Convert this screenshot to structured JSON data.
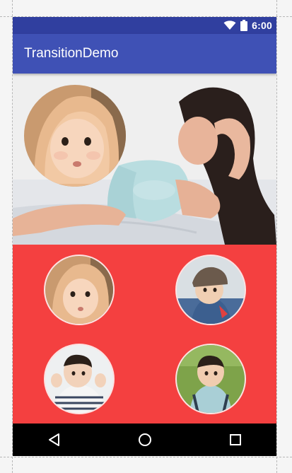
{
  "status_bar": {
    "time": "6:00",
    "icons": [
      "wifi-icon",
      "battery-icon"
    ],
    "color": "#303F9F"
  },
  "app_bar": {
    "title": "TransitionDemo",
    "color": "#3F51B5"
  },
  "hero": {
    "image": "woman-lying-photo",
    "overlay_avatar": "baby-hood-photo"
  },
  "grid": {
    "background": "#F44040",
    "avatars": [
      {
        "image": "baby-hood-photo"
      },
      {
        "image": "toddler-cap-photo"
      },
      {
        "image": "toddler-striped-shirt-photo"
      },
      {
        "image": "toddler-grass-photo"
      }
    ]
  },
  "nav_bar": {
    "buttons": [
      "back-icon",
      "home-icon",
      "recents-icon"
    ]
  }
}
